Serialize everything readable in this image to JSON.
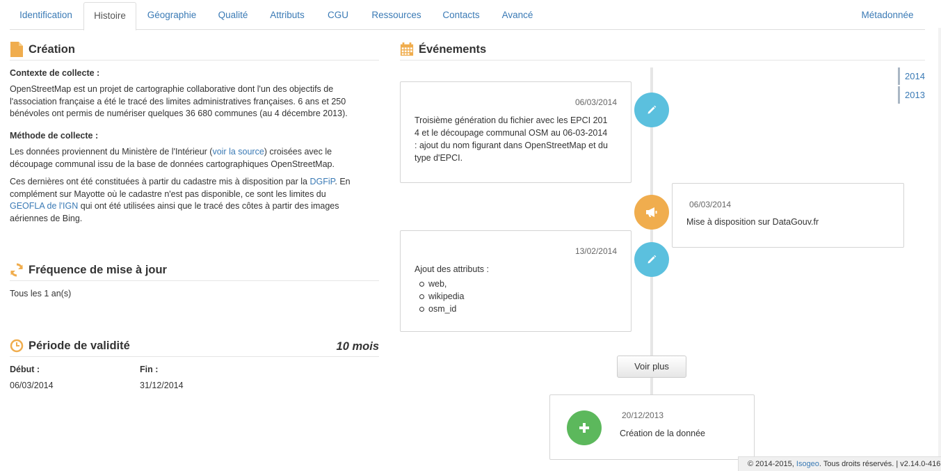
{
  "tabs": [
    "Identification",
    "Histoire",
    "Géographie",
    "Qualité",
    "Attributs",
    "CGU",
    "Ressources",
    "Contacts",
    "Avancé"
  ],
  "tab_right": "Métadonnée",
  "creation": {
    "title": "Création",
    "contexte_label": "Contexte de collecte :",
    "contexte_lines": [
      "OpenStreetMap est un projet de cartographie collaborative dont l'un des objectifs de",
      "l'association française a été le tracé des limites administratives françaises. 6 ans et 250",
      "bénévoles ont permis de numériser quelques 36 680 communes (au 4 décembre 2013)."
    ],
    "methode_label": "Méthode de collecte :",
    "methode_p1_a": "Les données proviennent du Ministère de l'Intérieur (",
    "methode_p1_link": "voir la source",
    "methode_p1_b": ") croisées avec le",
    "methode_p1_line2": "découpage communal issu de la base de données cartographiques OpenStreetMap.",
    "methode_p2_a": "Ces dernières ont été constituées à partir du cadastre mis à disposition par la ",
    "methode_p2_link1": "DGFiP",
    "methode_p2_b": ". En",
    "methode_p2_line2": "complément sur Mayotte où le cadastre n'est pas disponible, ce sont les limites du",
    "methode_p2_link2": "GEOFLA de l'IGN",
    "methode_p2_c": " qui ont été utilisées ainsi que le tracé des côtes à partir des images",
    "methode_p2_line4": "aériennes de Bing."
  },
  "frequence": {
    "title": "Fréquence de mise à jour",
    "value": "Tous les 1 an(s)"
  },
  "validite": {
    "title": "Période de validité",
    "duration": "10 mois",
    "debut_label": "Début :",
    "debut": "06/03/2014",
    "fin_label": "Fin :",
    "fin": "31/12/2014"
  },
  "evenements": {
    "title": "Événements",
    "years": [
      "2014",
      "2013"
    ],
    "events": [
      {
        "date": "06/03/2014",
        "lines": [
          "Troisième génération du fichier avec les EPCI 201",
          "4 et le découpage communal OSM au 06-03-2014",
          ": ajout du nom figurant dans OpenStreetMap et du",
          "type d'EPCI."
        ],
        "icon": "pencil-icon"
      },
      {
        "date": "06/03/2014",
        "lines": [
          "Mise à disposition sur DataGouv.fr"
        ],
        "icon": "megaphone-icon"
      },
      {
        "date": "13/02/2014",
        "intro": "Ajout des attributs :",
        "items": [
          "web,",
          "wikipedia",
          "osm_id"
        ],
        "icon": "pencil-icon"
      },
      {
        "date": "20/12/2013",
        "lines": [
          "Création de la donnée"
        ],
        "icon": "plus-icon"
      }
    ],
    "voir_plus": "Voir plus"
  },
  "footer": {
    "prefix": "© 2014-2015, ",
    "link": "Isogeo",
    "suffix": ". Tous droits réservés. | v2.14.0-416"
  },
  "colors": {
    "accent_orange": "#f0ad4e",
    "badge_blue": "#5bc0de",
    "badge_green": "#5cb85c",
    "link": "#3a7ab5"
  }
}
